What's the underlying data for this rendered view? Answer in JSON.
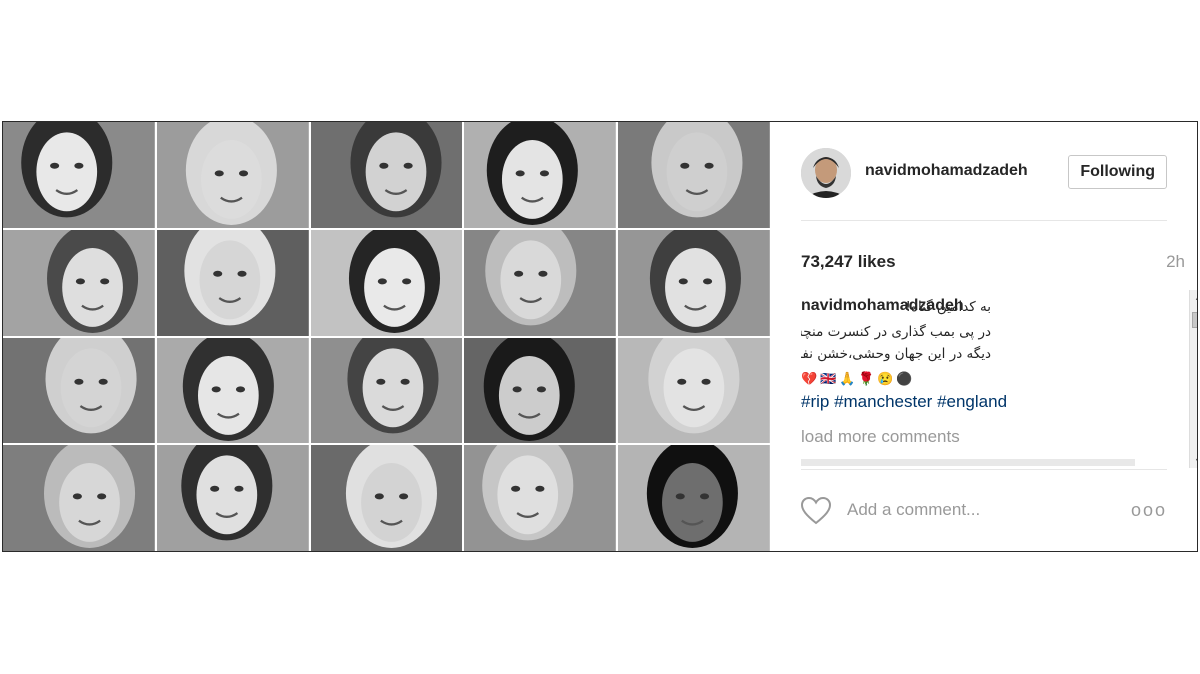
{
  "post": {
    "username": "navidmohamadzadeh",
    "follow_label": "Following",
    "likes": "73,247 likes",
    "time": "2h",
    "caption": {
      "username": "navidmohamadzadeh",
      "line1": "به کدامین گناه!",
      "line2": "در پی بمب گذاری در کنسرت منچستر ،این بچه ها",
      "line3": "دیگه در این جهان وحشی،خشن نفس نمی کشن",
      "emojis": [
        "💔",
        "🇬🇧",
        "🙏",
        "🌹",
        "😢",
        "⚫"
      ],
      "hashtags": "#rip #manchester #england"
    },
    "load_more": "load more comments",
    "comment_placeholder": "Add a comment...",
    "more_icon": "ooo"
  },
  "icons": {
    "heart": "heart-icon",
    "more": "more-options-icon"
  },
  "colors": {
    "username": "#262626",
    "hashtag": "#003569",
    "muted": "#999999",
    "border": "#e6e6e6"
  }
}
